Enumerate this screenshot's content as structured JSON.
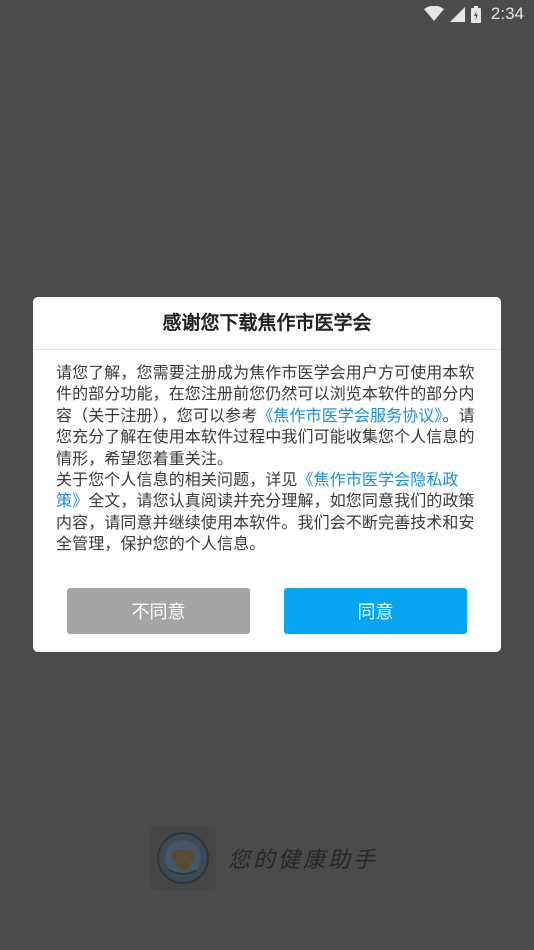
{
  "status_bar": {
    "time": "2:34",
    "icons": [
      "wifi-icon",
      "cell-signal-icon",
      "battery-icon"
    ]
  },
  "dialog": {
    "title": "感谢您下载焦作市医学会",
    "paragraph1": {
      "text_before": "请您了解，您需要注册成为焦作市医学会用户方可使用本软件的部分功能，在您注册前您仍然可以浏览本软件的部分内容（关于注册），您可以参考",
      "link": "《焦作市医学会服务协议》",
      "text_after": "。请您充分了解在使用本软件过程中我们可能收集您个人信息的情形，希望您着重关注。"
    },
    "paragraph2": {
      "text_before": "关于您个人信息的相关问题，详见",
      "link": "《焦作市医学会隐私政策》",
      "text_after": "全文，请您认真阅读并充分理解，如您同意我们的政策内容，请同意并继续使用本软件。我们会不断完善技术和安全管理，保护您的个人信息。"
    },
    "disagree_label": "不同意",
    "agree_label": "同意"
  },
  "brand": {
    "slogan": "您的健康助手"
  },
  "colors": {
    "overlay_background": "#4b4b4b",
    "link": "#1a8fd6",
    "agree_button": "#05a6ef",
    "disagree_button": "#a5a5a5"
  }
}
